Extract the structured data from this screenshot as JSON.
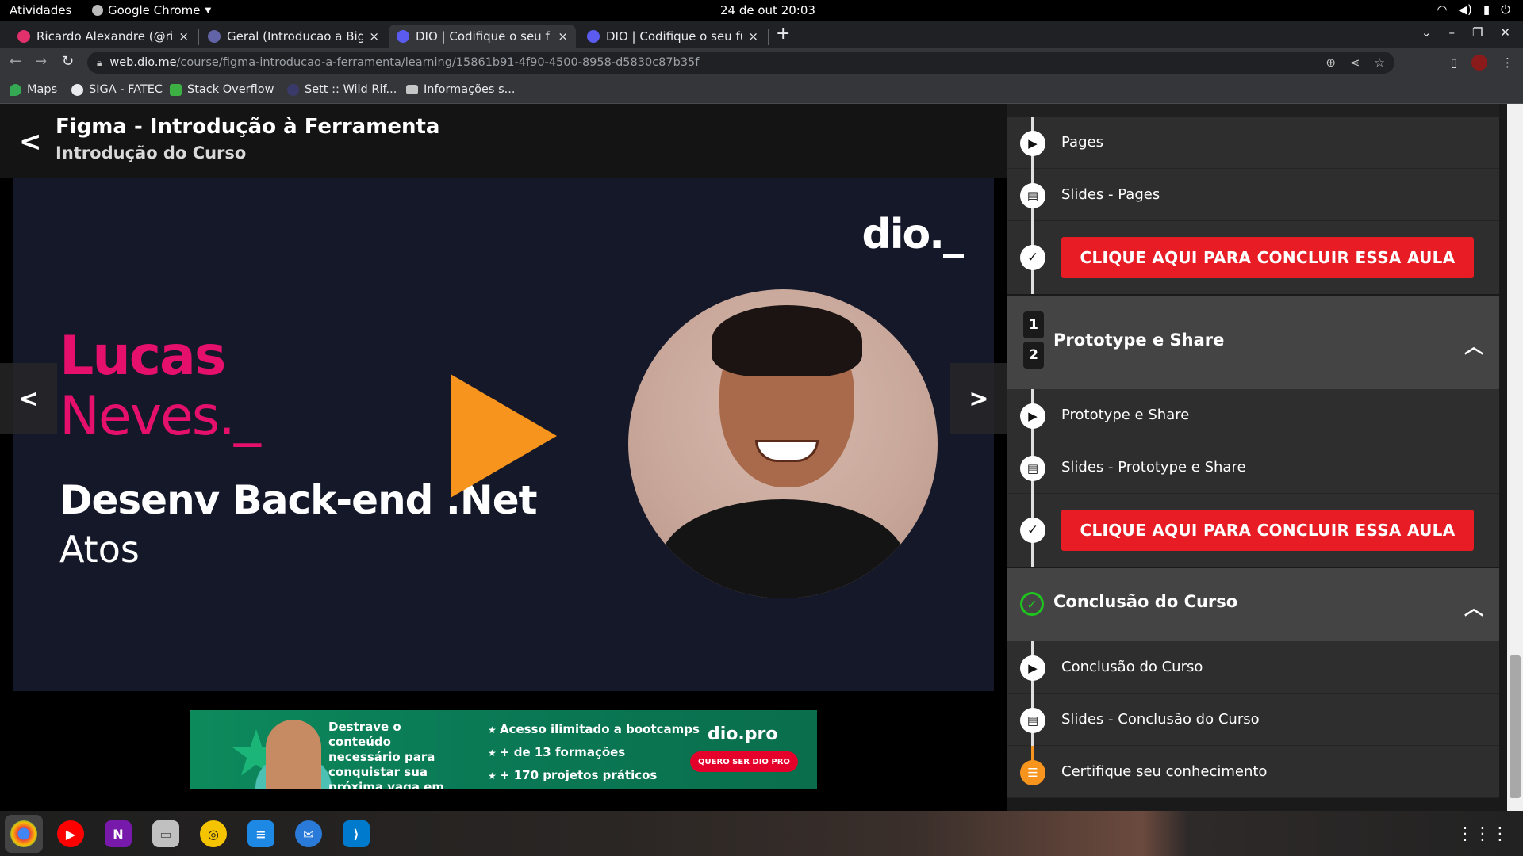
{
  "system_bar": {
    "activities": "Atividades",
    "app_name": "Google Chrome",
    "datetime": "24 de out  20:03"
  },
  "tabs": [
    {
      "title": "Ricardo Alexandre (@rica",
      "favicon_color": "#e1306c",
      "active": false
    },
    {
      "title": "Geral (Introducao a Big D",
      "favicon_color": "#6264a7",
      "active": false
    },
    {
      "title": "DIO | Codifique o seu futu",
      "favicon_color": "#5b5bf0",
      "active": true
    },
    {
      "title": "DIO | Codifique o seu futu",
      "favicon_color": "#5b5bf0",
      "active": false
    }
  ],
  "tab_close_glyph": "×",
  "address_bar": {
    "host": "web.dio.me",
    "path": "/course/figma-introducao-a-ferramenta/learning/15861b91-4f90-4500-8958-d5830c87b35f"
  },
  "bookmarks": [
    {
      "label": "Maps",
      "icon_color": "#34a853"
    },
    {
      "label": "SIGA - FATEC",
      "icon_color": "#e8eaed"
    },
    {
      "label": "Stack Overflow",
      "icon_color": "#3cb043"
    },
    {
      "label": "Sett :: Wild Rif...",
      "icon_color": "#3a3a6a"
    },
    {
      "label": "Informações s...",
      "icon_color": "#c4c7c5"
    }
  ],
  "course": {
    "title": "Figma - Introdução à Ferramenta",
    "subtitle": "Introdução do Curso"
  },
  "video": {
    "logo": "dio._",
    "first_name": "Lucas",
    "last_name": "Neves._",
    "role": "Desenv Back-end .Net",
    "company": "Atos"
  },
  "banner": {
    "text": "Destrave o conteúdo necessário para conquistar sua próxima vaga em tecnologia.",
    "features": [
      "Acesso ilimitado a bootcamps",
      "+ de 13 formações",
      "+ 170 projetos práticos"
    ],
    "logo": "dio.pro",
    "cta": "QUERO SER DIO PRO"
  },
  "sidebar": {
    "section1_lessons": [
      {
        "label": "Pages",
        "icon": "play-icon"
      },
      {
        "label": "Slides - Pages",
        "icon": "document-icon"
      }
    ],
    "complete_label": "CLIQUE AQUI PARA CONCLUIR ESSA AULA",
    "section2": {
      "number_top": "1",
      "number_bottom": "2",
      "title": "Prototype e Share",
      "lessons": [
        {
          "label": "Prototype e Share",
          "icon": "play-icon"
        },
        {
          "label": "Slides - Prototype e Share",
          "icon": "document-icon"
        }
      ]
    },
    "section3": {
      "title": "Conclusão do Curso",
      "lessons": [
        {
          "label": "Conclusão do Curso",
          "icon": "play-icon"
        },
        {
          "label": "Slides - Conclusão do Curso",
          "icon": "document-icon"
        },
        {
          "label": "Certifique seu conhecimento",
          "icon": "list-icon"
        }
      ]
    }
  },
  "taskbar_apps": [
    {
      "name": "chrome-icon",
      "color": "#4285f4",
      "glyph": "◉"
    },
    {
      "name": "youtube-music-icon",
      "color": "#ff0000",
      "glyph": "▶"
    },
    {
      "name": "onenote-icon",
      "color": "#7719aa",
      "glyph": "N"
    },
    {
      "name": "files-icon",
      "color": "#c0c0c0",
      "glyph": "▭"
    },
    {
      "name": "rhythmbox-icon",
      "color": "#f5c400",
      "glyph": "◎"
    },
    {
      "name": "writer-icon",
      "color": "#1e88e5",
      "glyph": "≡"
    },
    {
      "name": "thunderbird-icon",
      "color": "#2a7ad9",
      "glyph": "✉"
    },
    {
      "name": "vscode-icon",
      "color": "#007acc",
      "glyph": "⟩"
    }
  ],
  "colors": {
    "accent_pink": "#e4106b",
    "play_orange": "#f7941d",
    "complete_red": "#e81c24",
    "success_green": "#1ec51e"
  }
}
